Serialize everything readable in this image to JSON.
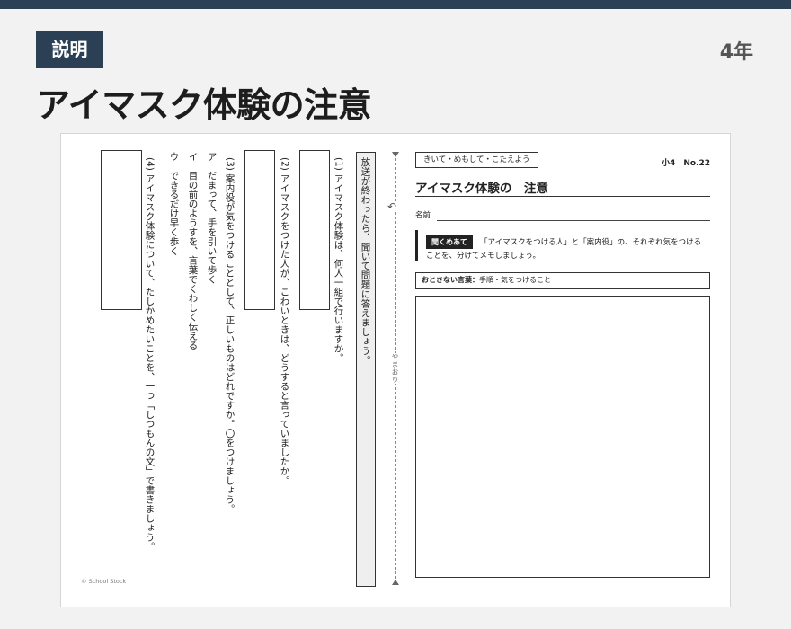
{
  "header": {
    "badge": "説明",
    "grade": "4年",
    "title": "アイマスク体験の注意"
  },
  "worksheet": {
    "tag": "きいて・めもして・こたえよう",
    "doc_number": "小4　No.22",
    "title": "アイマスク体験の　注意",
    "name_label": "名前",
    "instruction_badge": "聞くめあて",
    "instruction_line1": "「アイマスクをつける人」と「案内役」の、それぞれ気をつける",
    "instruction_line2": "ことを、分けてメモしましょう。",
    "key_label": "おとさない言葉：",
    "key_text": "手順・気をつけること",
    "fold_label": "やまおり",
    "copyright": "© School Stock"
  },
  "questions": {
    "header": "放送が終わったら、聞いて問題に答えましょう。",
    "q1": "(1) アイマスク体験は、何人一組で行いますか。",
    "q2": "(2) アイマスクをつけた人が、こわいときは、どうすると言っていましたか。",
    "q3": "(3) 案内役が気をつけることとして、正しいものはどれですか。〇をつけましょう。",
    "q3_a": "ア　だまって、手を引いて歩く",
    "q3_i": "イ　目の前のようすを、言葉でくわしく伝える",
    "q3_u": "ウ　できるだけ早く歩く",
    "q4": "(4) アイマスク体験について、たしかめたいことを、一つ「しつもんの文」で書きましょう。"
  }
}
